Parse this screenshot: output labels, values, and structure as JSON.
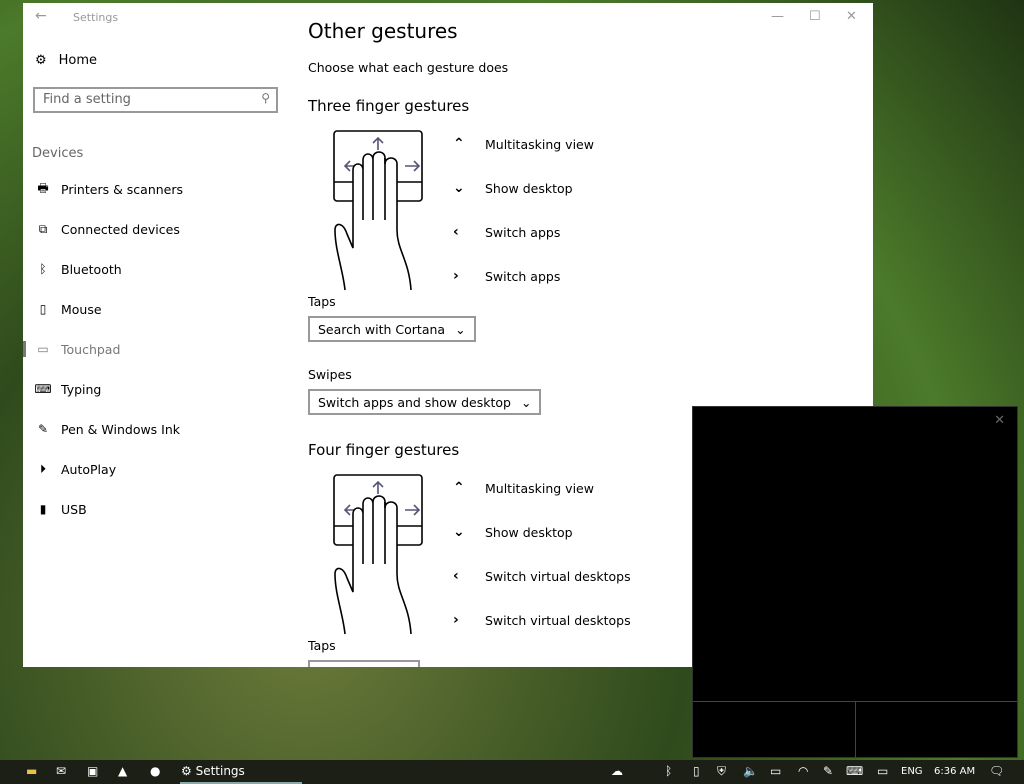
{
  "window": {
    "title": "Settings",
    "back": "←",
    "minimize": "—",
    "maximize": "☐",
    "close": "✕"
  },
  "sidebar": {
    "home": "Home",
    "search_placeholder": "Find a setting",
    "category": "Devices",
    "items": [
      {
        "label": "Printers & scanners",
        "icon": "🖶"
      },
      {
        "label": "Connected devices",
        "icon": "⧉"
      },
      {
        "label": "Bluetooth",
        "icon": "ᛒ"
      },
      {
        "label": "Mouse",
        "icon": "▯"
      },
      {
        "label": "Touchpad",
        "icon": "▭"
      },
      {
        "label": "Typing",
        "icon": "⌨"
      },
      {
        "label": "Pen & Windows Ink",
        "icon": "✎"
      },
      {
        "label": "AutoPlay",
        "icon": "⏵"
      },
      {
        "label": "USB",
        "icon": "▮"
      }
    ],
    "selected": "Touchpad"
  },
  "main": {
    "title": "Other gestures",
    "subtitle": "Choose what each gesture does",
    "three": {
      "heading": "Three finger gestures",
      "gestures": [
        {
          "arrow": "up",
          "label": "Multitasking view"
        },
        {
          "arrow": "down",
          "label": "Show desktop"
        },
        {
          "arrow": "left",
          "label": "Switch apps"
        },
        {
          "arrow": "right",
          "label": "Switch apps"
        }
      ],
      "taps_label": "Taps",
      "taps_value": "Search with Cortana",
      "swipes_label": "Swipes",
      "swipes_value": "Switch apps and show desktop"
    },
    "four": {
      "heading": "Four finger gestures",
      "gestures": [
        {
          "arrow": "up",
          "label": "Multitasking view"
        },
        {
          "arrow": "down",
          "label": "Show desktop"
        },
        {
          "arrow": "left",
          "label": "Switch virtual desktops"
        },
        {
          "arrow": "right",
          "label": "Switch virtual desktops"
        }
      ],
      "taps_label": "Taps"
    }
  },
  "taskbar": {
    "app": "Settings",
    "language": "ENG",
    "time": "6:36 AM"
  }
}
